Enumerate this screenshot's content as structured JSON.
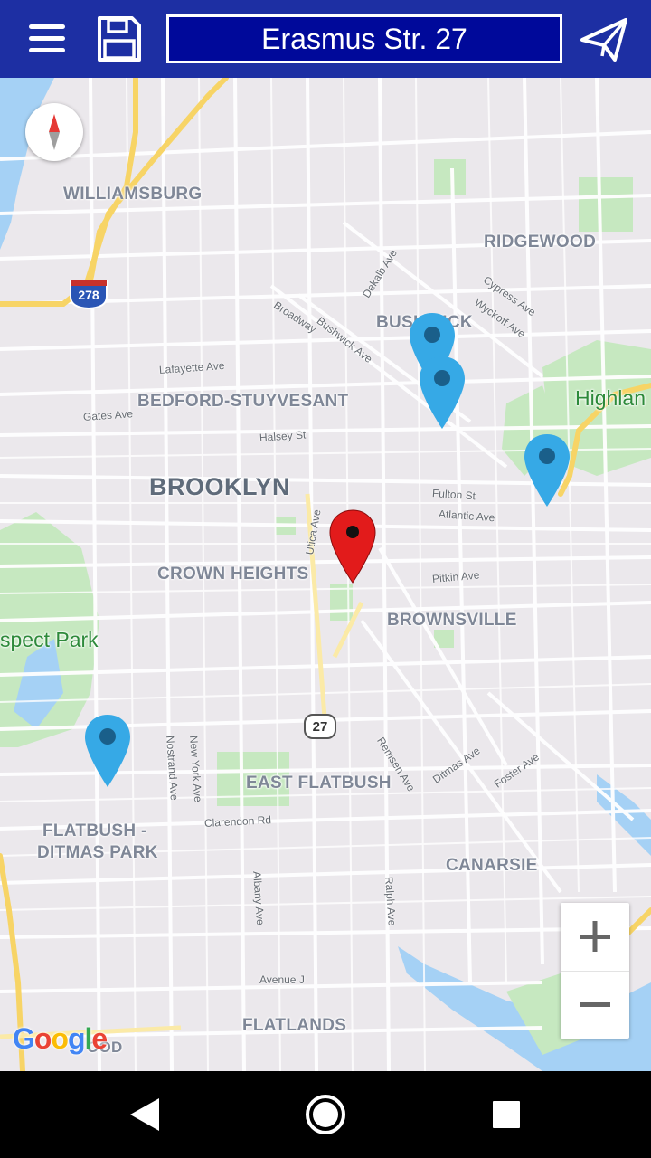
{
  "header": {
    "address": "Erasmus Str. 27",
    "menu_icon": "hamburger-menu-icon",
    "save_icon": "floppy-disk-save-icon",
    "send_icon": "paper-plane-send-icon"
  },
  "map": {
    "areas": [
      "WILLIAMSBURG",
      "RIDGEWOOD",
      "BUSHWICK",
      "BEDFORD-STUYVESANT",
      "BROOKLYN",
      "CROWN HEIGHTS",
      "BROWNSVILLE",
      "EAST FLATBUSH",
      "FLATBUSH -",
      "DITMAS PARK",
      "CANARSIE",
      "FLATLANDS",
      "Highlan",
      "spect Park",
      "OOD"
    ],
    "streets": [
      "Dekalb Ave",
      "Cypress Ave",
      "Wyckoff Ave",
      "Broadway",
      "Bushwick Ave",
      "Lafayette Ave",
      "Gates Ave",
      "Halsey St",
      "Fulton St",
      "Atlantic Ave",
      "Utica Ave",
      "Pitkin Ave",
      "Remsen Ave",
      "Ditmas Ave",
      "Foster Ave",
      "Nostrand Ave",
      "New York Ave",
      "Clarendon Rd",
      "Albany Ave",
      "Ralph Ave",
      "Avenue J"
    ],
    "shields": [
      "278",
      "27"
    ],
    "attribution": "Google",
    "colors": {
      "selected_pin": "#e21b1b",
      "other_pin": "#36a9e6",
      "park": "#c6e8c0",
      "water": "#a5d1f5",
      "highway": "#f7d466",
      "header": "#1d2fa3",
      "address_box": "#00099a"
    }
  },
  "controls": {
    "zoom_in": "+",
    "zoom_out": "−",
    "compass_icon": "compass-icon"
  },
  "nav": {
    "back_icon": "back-triangle-icon",
    "home_icon": "home-circle-icon",
    "recents_icon": "recents-square-icon"
  }
}
